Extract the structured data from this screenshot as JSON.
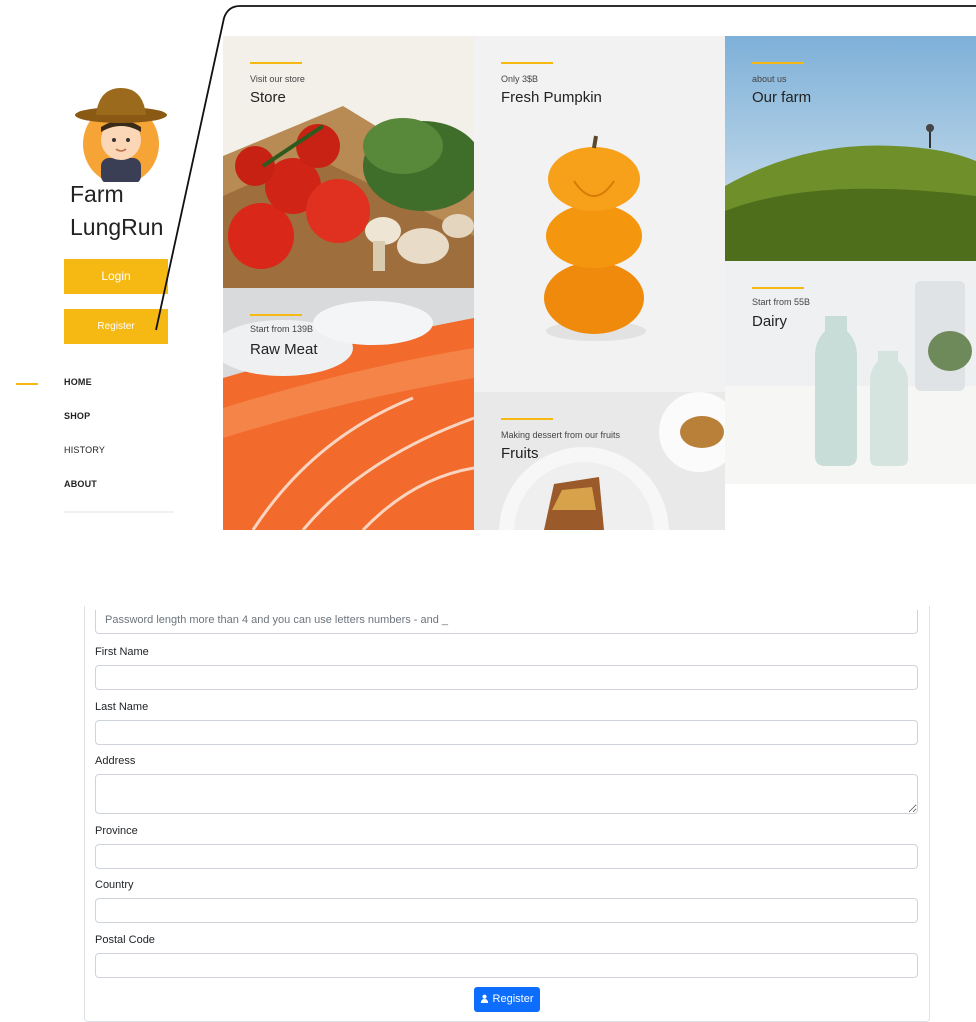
{
  "brand": {
    "line1": "Farm",
    "line2": "LungRun"
  },
  "auth": {
    "login_label": "Login",
    "register_label": "Register"
  },
  "nav": {
    "home": "HOME",
    "shop": "SHOP",
    "history": "HISTORY",
    "about": "ABOUT"
  },
  "tiles": {
    "store": {
      "subtitle": "Visit our store",
      "title": "Store"
    },
    "pumpkin": {
      "subtitle": "Only 3$B",
      "title": "Fresh Pumpkin"
    },
    "farm": {
      "subtitle": "about us",
      "title": "Our farm"
    },
    "meat": {
      "subtitle": "Start from 139B",
      "title": "Raw Meat"
    },
    "dairy": {
      "subtitle": "Start from 55B",
      "title": "Dairy"
    },
    "fruits": {
      "subtitle": "Making dessert from our fruits",
      "title": "Fruits"
    }
  },
  "form": {
    "password_hint": "Password length more than 4 and you can use letters numbers - and _",
    "first_name_label": "First Name",
    "last_name_label": "Last Name",
    "address_label": "Address",
    "province_label": "Province",
    "country_label": "Country",
    "postal_code_label": "Postal Code",
    "submit_label": "Register",
    "submit_icon": "user-plus-icon"
  },
  "colors": {
    "accent": "#f6b914",
    "primary": "#0d6efd"
  }
}
